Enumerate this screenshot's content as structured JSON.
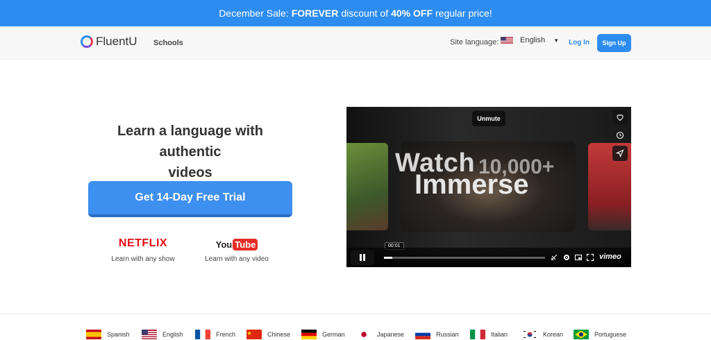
{
  "promo": {
    "prefix": "December Sale:",
    "highlight": "FOREVER",
    "middle": "discount of",
    "percent": "40% OFF",
    "suffix": "regular price!",
    "background": "#2d8cf0"
  },
  "nav": {
    "logo_text": "FluentU",
    "schools": "Schools",
    "site_language_label": "Site language:",
    "language_value": "English",
    "login": "Log In",
    "signup": "Sign Up"
  },
  "hero": {
    "headline_line1": "Learn a language with authentic",
    "headline_line2": "videos",
    "cta": "Get 14-Day Free Trial"
  },
  "brands": [
    {
      "name": "NETFLIX",
      "caption": "Learn with any show"
    },
    {
      "name_you": "You",
      "name_tube": "Tube",
      "caption": "Learn with any video"
    }
  ],
  "video": {
    "unmute": "Unmute",
    "overlay_watch": "Watch",
    "overlay_count": "10,000+",
    "overlay_immerse": "Immerse",
    "time": "00:01",
    "progress": 0.05,
    "brand": "vimeo"
  },
  "languages": [
    {
      "label": "Spanish",
      "flag": "es"
    },
    {
      "label": "English",
      "flag": "us"
    },
    {
      "label": "French",
      "flag": "fr"
    },
    {
      "label": "Chinese",
      "flag": "cn"
    },
    {
      "label": "German",
      "flag": "de"
    },
    {
      "label": "Japanese",
      "flag": "jp"
    },
    {
      "label": "Russian",
      "flag": "ru"
    },
    {
      "label": "Italian",
      "flag": "it"
    },
    {
      "label": "Korean",
      "flag": "kr"
    },
    {
      "label": "Portuguese",
      "flag": "br"
    }
  ]
}
